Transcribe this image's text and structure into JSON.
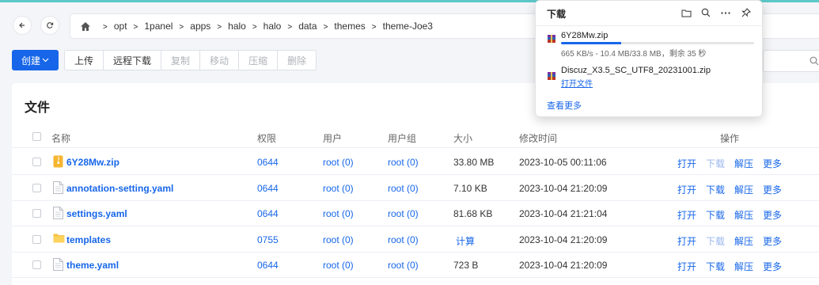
{
  "nav": {
    "back_icon": "arrow-left-icon",
    "refresh_icon": "refresh-icon",
    "home_icon": "home-icon",
    "breadcrumbs": [
      "opt",
      "1panel",
      "apps",
      "halo",
      "halo",
      "data",
      "themes",
      "theme-Joe3"
    ]
  },
  "toolbar": {
    "create_label": "创建",
    "buttons": [
      {
        "label": "上传",
        "enabled": true
      },
      {
        "label": "远程下载",
        "enabled": true
      },
      {
        "label": "复制",
        "enabled": false
      },
      {
        "label": "移动",
        "enabled": false
      },
      {
        "label": "压缩",
        "enabled": false
      },
      {
        "label": "删除",
        "enabled": false
      }
    ]
  },
  "files_panel": {
    "title": "文件",
    "columns": {
      "name": "名称",
      "perm": "权限",
      "user": "用户",
      "group": "用户组",
      "size": "大小",
      "mtime": "修改时间",
      "ops": "操作"
    },
    "rows": [
      {
        "name": "6Y28Mw.zip",
        "icon": "zip-file-icon",
        "perm": "0644",
        "user": "root (0)",
        "group": "root (0)",
        "size": "33.80 MB",
        "size_link": false,
        "mtime": "2023-10-05 00:11:06",
        "download_enabled": false
      },
      {
        "name": "annotation-setting.yaml",
        "icon": "file-icon",
        "perm": "0644",
        "user": "root (0)",
        "group": "root (0)",
        "size": "7.10 KB",
        "size_link": false,
        "mtime": "2023-10-04 21:20:09",
        "download_enabled": true
      },
      {
        "name": "settings.yaml",
        "icon": "file-icon",
        "perm": "0644",
        "user": "root (0)",
        "group": "root (0)",
        "size": "81.68 KB",
        "size_link": false,
        "mtime": "2023-10-04 21:21:04",
        "download_enabled": true
      },
      {
        "name": "templates",
        "icon": "folder-icon",
        "perm": "0755",
        "user": "root (0)",
        "group": "root (0)",
        "size": "计算",
        "size_link": true,
        "mtime": "2023-10-04 21:20:09",
        "download_enabled": false
      },
      {
        "name": "theme.yaml",
        "icon": "file-icon",
        "perm": "0644",
        "user": "root (0)",
        "group": "root (0)",
        "size": "723 B",
        "size_link": false,
        "mtime": "2023-10-04 21:20:09",
        "download_enabled": true
      }
    ],
    "actions": {
      "open": "打开",
      "download": "下载",
      "extract": "解压",
      "more": "更多"
    }
  },
  "downloads": {
    "title": "下载",
    "icons": [
      "folder-icon",
      "search-icon",
      "more-icon",
      "pin-icon"
    ],
    "items": [
      {
        "name": "6Y28Mw.zip",
        "status": "665 KB/s - 10.4 MB/33.8 MB，剩余 35 秒",
        "progress": 0.31
      },
      {
        "name": "Discuz_X3.5_SC_UTF8_20231001.zip",
        "link": "打开文件"
      }
    ],
    "see_more": "查看更多"
  }
}
